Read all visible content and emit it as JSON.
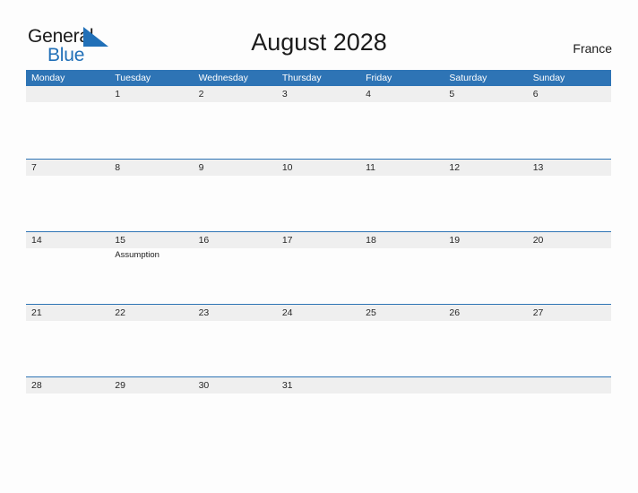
{
  "brand": {
    "name_part1": "General",
    "name_part2": "Blue",
    "flag_icon": "blue-triangle-flag-icon",
    "color_dark": "#1a1a1a",
    "color_blue": "#2170b8"
  },
  "header": {
    "title": "August 2028",
    "locale": "France"
  },
  "calendar": {
    "accent_color": "#2e74b5",
    "band_color": "#efefef",
    "month": "August",
    "year": "2028",
    "first_day_of_week": "Monday",
    "weekdays": [
      "Monday",
      "Tuesday",
      "Wednesday",
      "Thursday",
      "Friday",
      "Saturday",
      "Sunday"
    ],
    "weeks": [
      [
        {
          "date": "",
          "events": []
        },
        {
          "date": "1",
          "events": []
        },
        {
          "date": "2",
          "events": []
        },
        {
          "date": "3",
          "events": []
        },
        {
          "date": "4",
          "events": []
        },
        {
          "date": "5",
          "events": []
        },
        {
          "date": "6",
          "events": []
        }
      ],
      [
        {
          "date": "7",
          "events": []
        },
        {
          "date": "8",
          "events": []
        },
        {
          "date": "9",
          "events": []
        },
        {
          "date": "10",
          "events": []
        },
        {
          "date": "11",
          "events": []
        },
        {
          "date": "12",
          "events": []
        },
        {
          "date": "13",
          "events": []
        }
      ],
      [
        {
          "date": "14",
          "events": []
        },
        {
          "date": "15",
          "events": [
            "Assumption"
          ]
        },
        {
          "date": "16",
          "events": []
        },
        {
          "date": "17",
          "events": []
        },
        {
          "date": "18",
          "events": []
        },
        {
          "date": "19",
          "events": []
        },
        {
          "date": "20",
          "events": []
        }
      ],
      [
        {
          "date": "21",
          "events": []
        },
        {
          "date": "22",
          "events": []
        },
        {
          "date": "23",
          "events": []
        },
        {
          "date": "24",
          "events": []
        },
        {
          "date": "25",
          "events": []
        },
        {
          "date": "26",
          "events": []
        },
        {
          "date": "27",
          "events": []
        }
      ],
      [
        {
          "date": "28",
          "events": []
        },
        {
          "date": "29",
          "events": []
        },
        {
          "date": "30",
          "events": []
        },
        {
          "date": "31",
          "events": []
        },
        {
          "date": "",
          "events": []
        },
        {
          "date": "",
          "events": []
        },
        {
          "date": "",
          "events": []
        }
      ]
    ]
  }
}
